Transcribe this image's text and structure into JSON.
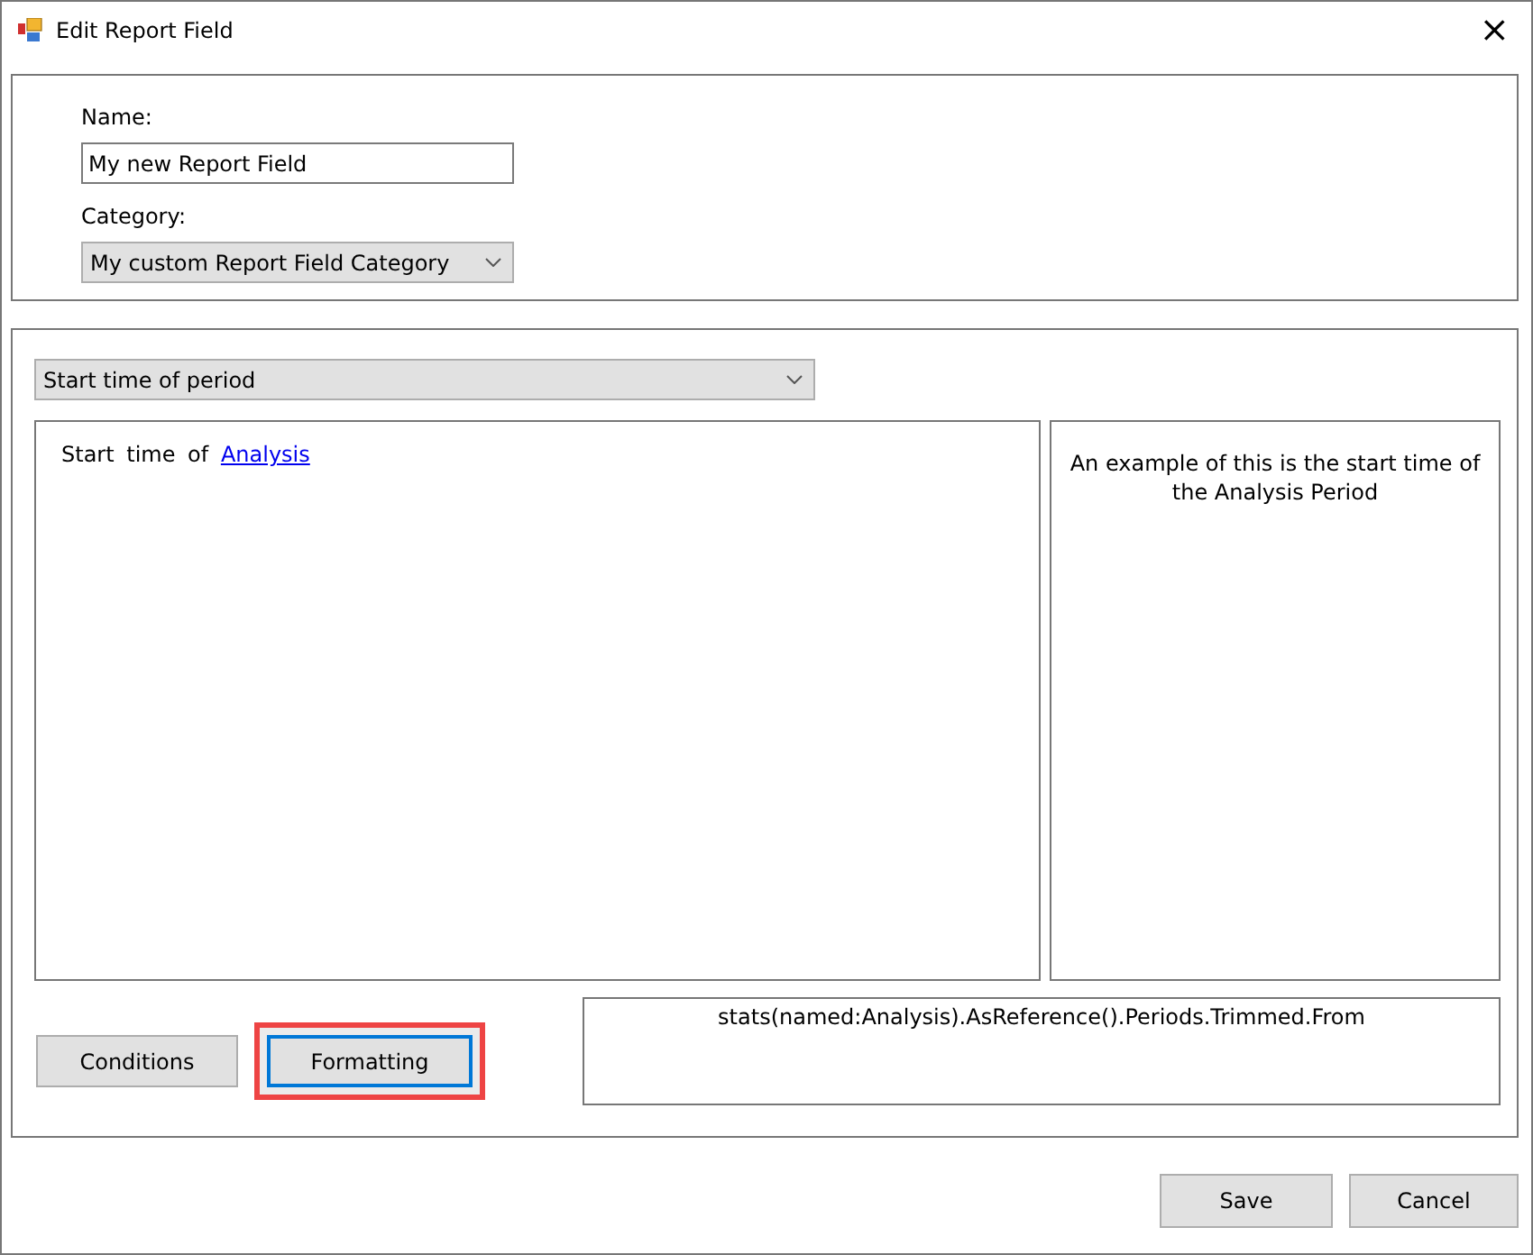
{
  "window": {
    "title": "Edit Report Field",
    "close": "×"
  },
  "name_field": {
    "label": "Name:",
    "value": "My new Report Field"
  },
  "category_field": {
    "label": "Category:",
    "value": "My custom Report Field Category"
  },
  "field_type": {
    "value": "Start time of period"
  },
  "description": {
    "text": "Start time of",
    "link": "Analysis"
  },
  "example": {
    "text": "An example of this is the start time of the Analysis Period"
  },
  "buttons": [
    {
      "label": "Conditions",
      "focused": false,
      "highlighted": false
    },
    {
      "label": "Formatting",
      "focused": true,
      "highlighted": true
    }
  ],
  "expression": {
    "text": "stats(named:Analysis).AsReference().Periods.Trimmed.From"
  },
  "footer_buttons": [
    {
      "label": "Save"
    },
    {
      "label": "Cancel"
    }
  ]
}
